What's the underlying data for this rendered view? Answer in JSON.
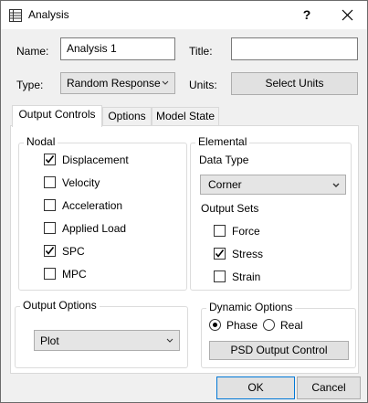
{
  "window": {
    "title": "Analysis",
    "help_label": "?"
  },
  "header": {
    "name_label": "Name:",
    "name_value": "Analysis 1",
    "title_label": "Title:",
    "title_value": "",
    "type_label": "Type:",
    "type_value": "Random Response",
    "units_label": "Units:",
    "select_units_label": "Select Units"
  },
  "tabs": [
    {
      "label": "Output Controls",
      "active": true
    },
    {
      "label": "Options",
      "active": false
    },
    {
      "label": "Model State",
      "active": false
    }
  ],
  "nodal": {
    "title": "Nodal",
    "items": [
      {
        "label": "Displacement",
        "checked": true
      },
      {
        "label": "Velocity",
        "checked": false
      },
      {
        "label": "Acceleration",
        "checked": false
      },
      {
        "label": "Applied Load",
        "checked": false
      },
      {
        "label": "SPC",
        "checked": true
      },
      {
        "label": "MPC",
        "checked": false
      }
    ]
  },
  "elemental": {
    "title": "Elemental",
    "data_type_label": "Data Type",
    "data_type_value": "Corner",
    "output_sets_label": "Output Sets",
    "items": [
      {
        "label": "Force",
        "checked": false
      },
      {
        "label": "Stress",
        "checked": true
      },
      {
        "label": "Strain",
        "checked": false
      }
    ]
  },
  "output_options": {
    "title": "Output Options",
    "value": "Plot"
  },
  "dynamic_options": {
    "title": "Dynamic Options",
    "phase_label": "Phase",
    "real_label": "Real",
    "selected": "Phase",
    "psd_button_label": "PSD Output Control"
  },
  "footer": {
    "ok_label": "OK",
    "cancel_label": "Cancel"
  },
  "colors": {
    "window_bg": "#f0f0f0",
    "panel_bg": "#ffffff",
    "button_bg": "#e1e1e1",
    "border": "#adadad"
  }
}
